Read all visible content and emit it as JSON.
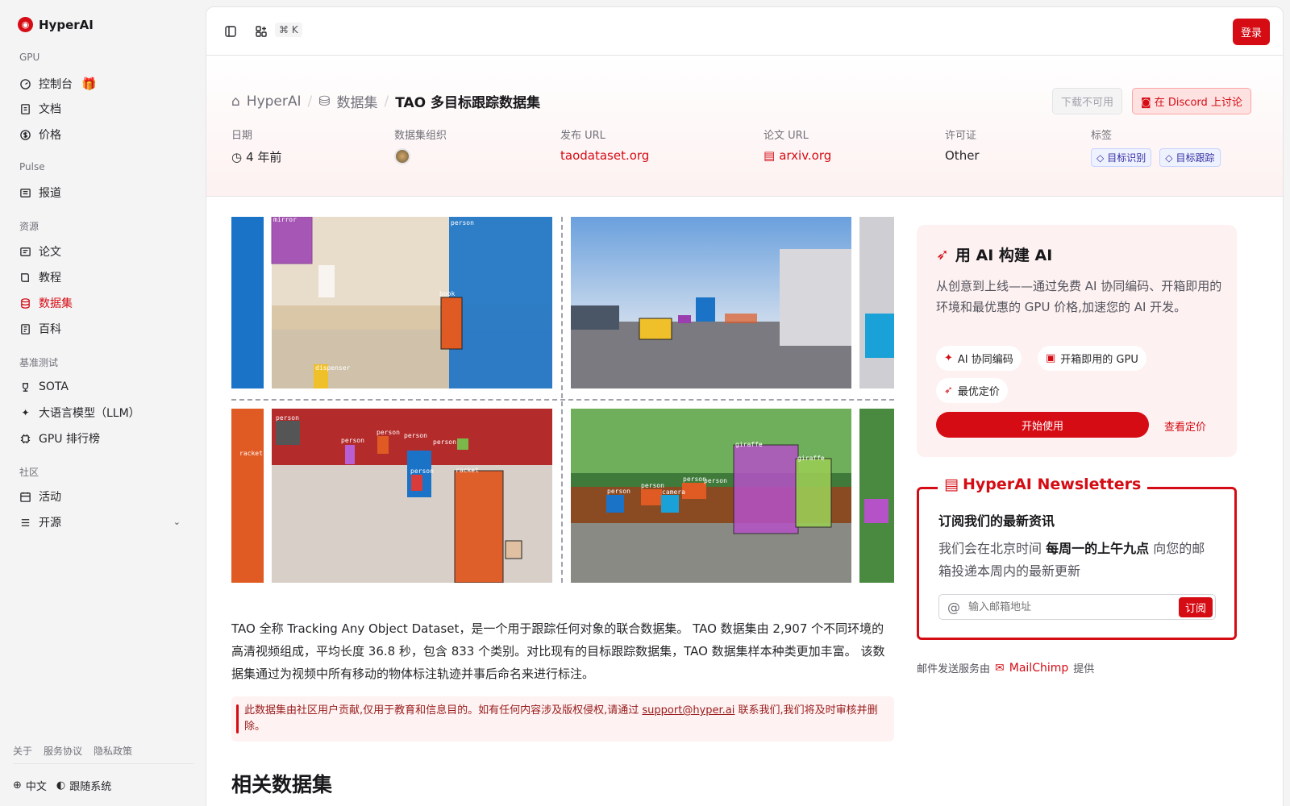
{
  "brand": {
    "name": "HyperAI",
    "accent": "#d50c14"
  },
  "sidebar": {
    "sections": [
      {
        "label": "GPU",
        "items": [
          {
            "label": "控制台",
            "icon": "gauge-icon"
          },
          {
            "label": "文档",
            "icon": "doc-icon"
          },
          {
            "label": "价格",
            "icon": "dollar-icon"
          }
        ]
      },
      {
        "label": "Pulse",
        "items": [
          {
            "label": "报道",
            "icon": "news-icon"
          }
        ]
      },
      {
        "label": "资源",
        "items": [
          {
            "label": "论文",
            "icon": "paper-icon"
          },
          {
            "label": "教程",
            "icon": "book-icon"
          },
          {
            "label": "数据集",
            "icon": "database-icon",
            "active": true
          },
          {
            "label": "百科",
            "icon": "wiki-icon"
          }
        ]
      },
      {
        "label": "基准测试",
        "items": [
          {
            "label": "SOTA",
            "icon": "trophy-icon"
          },
          {
            "label": "大语言模型（LLM）",
            "icon": "sparkle-icon"
          },
          {
            "label": "GPU 排行榜",
            "icon": "chip-icon"
          }
        ]
      },
      {
        "label": "社区",
        "items": [
          {
            "label": "活动",
            "icon": "calendar-icon"
          },
          {
            "label": "开源",
            "icon": "list-icon"
          }
        ]
      }
    ],
    "footer_links": [
      "关于",
      "服务协议",
      "隐私政策"
    ],
    "language": "中文",
    "theme": "跟随系统"
  },
  "topbar": {
    "shortcut": "⌘ K",
    "login": "登录"
  },
  "hero": {
    "breadcrumb": [
      "HyperAI",
      "数据集",
      "TAO 多目标跟踪数据集"
    ],
    "download": "下载不可用",
    "discord": "在 Discord 上讨论",
    "meta": [
      {
        "label": "日期",
        "value": "4 年前"
      },
      {
        "label": "数据集组织",
        "value": ""
      },
      {
        "label": "发布 URL",
        "value": "taodataset.org"
      },
      {
        "label": "论文 URL",
        "value": "arxiv.org"
      },
      {
        "label": "许可证",
        "value": "Other"
      },
      {
        "label": "标签",
        "tags": [
          "目标识别",
          "目标跟踪"
        ]
      }
    ]
  },
  "description": "TAO 全称 Tracking Any Object Dataset，是一个用于跟踪任何对象的联合数据集。 TAO 数据集由 2,907 个不同环境的高清视频组成，平均长度 36.8 秒，包含 833 个类别。对比现有的目标跟踪数据集，TAO 数据集样本种类更加丰富。 该数据集通过为视频中所有移动的物体标注轨迹并事后命名来进行标注。",
  "notice": {
    "before": "此数据集由社区用户贡献,仅用于教育和信息目的。如有任何内容涉及版权侵权,请通过 ",
    "email": "support@hyper.ai",
    "after": " 联系我们,我们将及时审核并删除。"
  },
  "related_title": "相关数据集",
  "promo": {
    "title": "用 AI 构建 AI",
    "desc": "从创意到上线——通过免费 AI 协同编码、开箱即用的环境和最优惠的 GPU 价格,加速您的 AI 开发。",
    "pills": [
      "AI 协同编码",
      "开箱即用的 GPU",
      "最优定价"
    ],
    "start": "开始使用",
    "pricing": "查看定价"
  },
  "newsletter": {
    "title": "HyperAI Newsletters",
    "subtitle": "订阅我们的最新资讯",
    "desc_before": "我们会在北京时间 ",
    "desc_bold": "每周一的上午九点",
    "desc_after": " 向您的邮箱投递本周内的最新更新",
    "placeholder": "输入邮箱地址",
    "button": "订阅"
  },
  "mailchimp": {
    "before": "邮件发送服务由",
    "brand": "MailChimp",
    "after": "提供"
  },
  "image_labels": {
    "t1": [
      "mirror",
      "person",
      "book",
      "dispenser"
    ],
    "t3": [
      "person",
      "person",
      "person",
      "person",
      "person",
      "racket",
      "person",
      "racket"
    ],
    "t4": [
      "giraffe",
      "giraffe",
      "person",
      "person",
      "camera",
      "person",
      "person"
    ]
  }
}
